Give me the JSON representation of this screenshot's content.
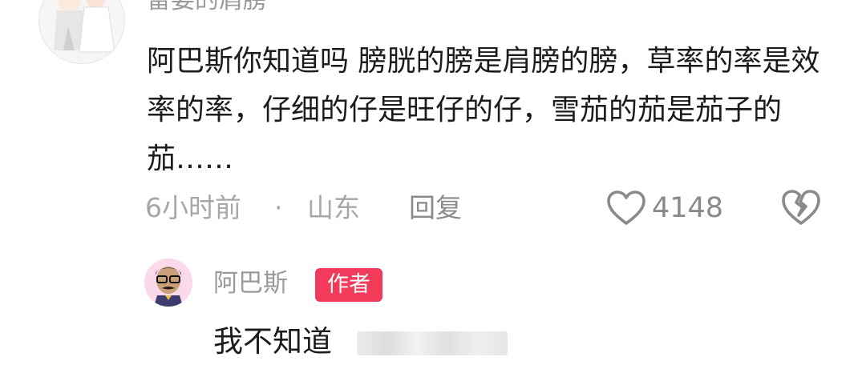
{
  "comment": {
    "username": "雷姿的肩膀",
    "text": "阿巴斯你知道吗 膀胱的膀是肩膀的膀，草率的率是效率的率，仔细的仔是旺仔的仔，雪茄的茄是茄子的茄……",
    "time": "6小时前",
    "separator": "·",
    "location": "山东",
    "reply_label": "回复",
    "like_count": "4148",
    "icons": {
      "like": "heart-outline-icon",
      "dislike": "broken-heart-icon"
    }
  },
  "reply": {
    "username": "阿巴斯",
    "badge": "作者",
    "text": "我不知道",
    "colors": {
      "badge_bg": "#f23a5a"
    }
  }
}
